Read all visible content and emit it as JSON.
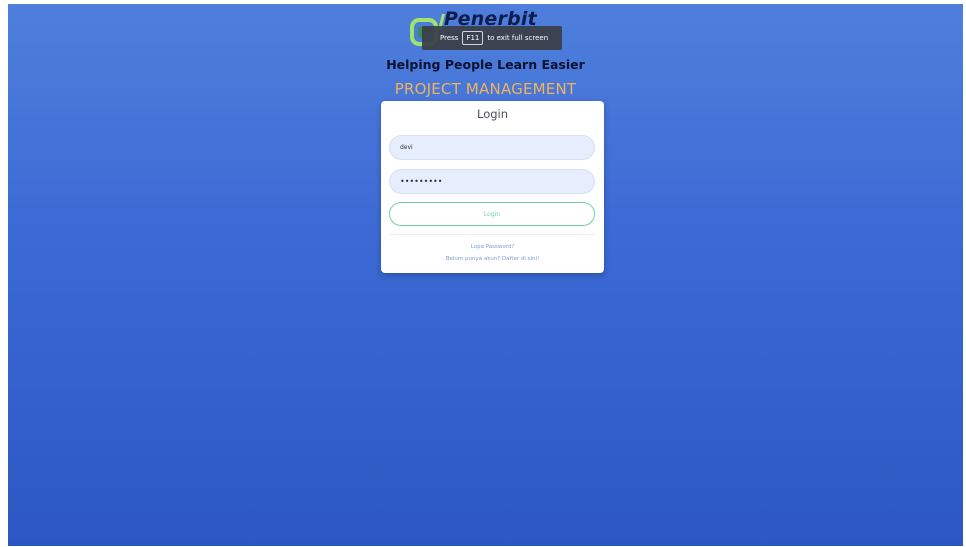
{
  "brand": {
    "name": "Penerbit",
    "tagline": "Helping People Learn Easier",
    "app_name": "PROJECT MANAGEMENT"
  },
  "fullscreen_tip": {
    "before": "Press",
    "key": "F11",
    "after": "to exit full screen"
  },
  "login": {
    "title": "Login",
    "username_value": "devi",
    "password_value": "•••••••••",
    "button_label": "Login",
    "forgot_link": "Lupa Password?",
    "register_link": "Belum punya akun? Daftar di sini!"
  },
  "colors": {
    "background_top": "#4f7fdb",
    "background_bottom": "#2c57c2",
    "accent_green": "#6fd3a1",
    "subtitle_orange": "#f2b35a",
    "link_blue": "#7f9ad6"
  }
}
